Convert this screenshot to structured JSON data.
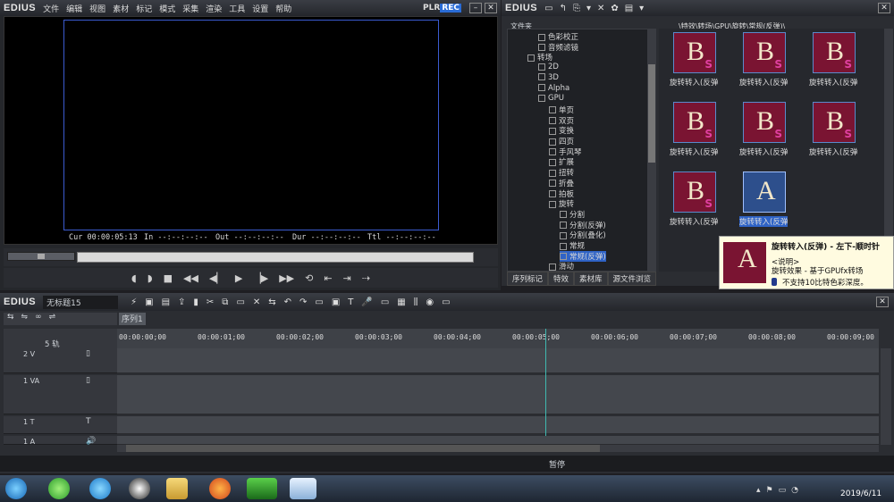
{
  "player": {
    "title": "EDIUS",
    "menu": [
      "文件",
      "编辑",
      "视图",
      "素材",
      "标记",
      "模式",
      "采集",
      "渲染",
      "工具",
      "设置",
      "帮助"
    ],
    "plr": "PLR",
    "rec": "REC",
    "timecode": {
      "cur_label": "Cur",
      "cur_value": "00:00:05:13",
      "in_label": "In",
      "in_value": "--:--:--:--",
      "out_label": "Out",
      "out_value": "--:--:--:--",
      "dur_label": "Dur",
      "dur_value": "--:--:--:--",
      "ttl_label": "Ttl",
      "ttl_value": "--:--:--:--"
    }
  },
  "effects": {
    "title": "EDIUS",
    "tree_header": "文件夹",
    "path": "\\特效\\转场\\GPU\\旋转\\常规(反弹)\\",
    "tree": [
      "色彩校正",
      "音频滤镜",
      "转场",
      "2D",
      "3D",
      "Alpha",
      "GPU",
      "单页",
      "双页",
      "变换",
      "四页",
      "手风琴",
      "扩展",
      "扭转",
      "折叠",
      "拍板",
      "旋转",
      "分割",
      "分割(反弹)",
      "分割(叠化)",
      "常规",
      "常规(反弹)",
      "滑动"
    ],
    "thumbs": [
      {
        "glyph": "B",
        "badge": "S",
        "caption": "旋转转入(反弹"
      },
      {
        "glyph": "B",
        "badge": "S",
        "caption": "旋转转入(反弹"
      },
      {
        "glyph": "B",
        "badge": "S",
        "caption": "旋转转入(反弹"
      },
      {
        "glyph": "B",
        "badge": "S",
        "caption": "旋转转入(反弹"
      },
      {
        "glyph": "B",
        "badge": "S",
        "caption": "旋转转入(反弹"
      },
      {
        "glyph": "B",
        "badge": "S",
        "caption": "旋转转入(反弹"
      },
      {
        "glyph": "B",
        "badge": "S",
        "caption": "旋转转入(反弹"
      },
      {
        "glyph": "A",
        "badge": "",
        "caption": "旋转转入(反弹"
      }
    ],
    "tabs": [
      "序列标记",
      "特效",
      "素材库",
      "源文件浏览"
    ]
  },
  "tooltip": {
    "title": "旋转转入(反弹) - 左下-顺时针",
    "desc_label": "<说明>",
    "desc": "旋转效果 - 基于GPUfx转场",
    "note": "不支持10比特色彩深度。"
  },
  "timeline": {
    "title": "EDIUS",
    "project": "无标题15",
    "sequence_tab": "序列1",
    "track_count": "5 轨",
    "ruler": [
      "00:00:00;00",
      "00:00:01;00",
      "00:00:02;00",
      "00:00:03;00",
      "00:00:04;00",
      "00:00:05;00",
      "00:00:06;00",
      "00:00:07;00",
      "00:00:08;00",
      "00:00:09;00"
    ],
    "tracks": [
      {
        "id": "2 V",
        "type": "V"
      },
      {
        "id": "1 VA",
        "type": "VA"
      },
      {
        "id": "1 T",
        "type": "T"
      },
      {
        "id": "1 A",
        "type": "A"
      }
    ],
    "status": "暂停",
    "playhead_seconds": 5.44
  },
  "taskbar": {
    "date": "2019/6/11"
  },
  "colors": {
    "frame_border": "#3b5bd0",
    "rec_bg": "#2a6cd6",
    "playhead": "#3fb8b0",
    "thumb_bg": "#7a1432"
  }
}
